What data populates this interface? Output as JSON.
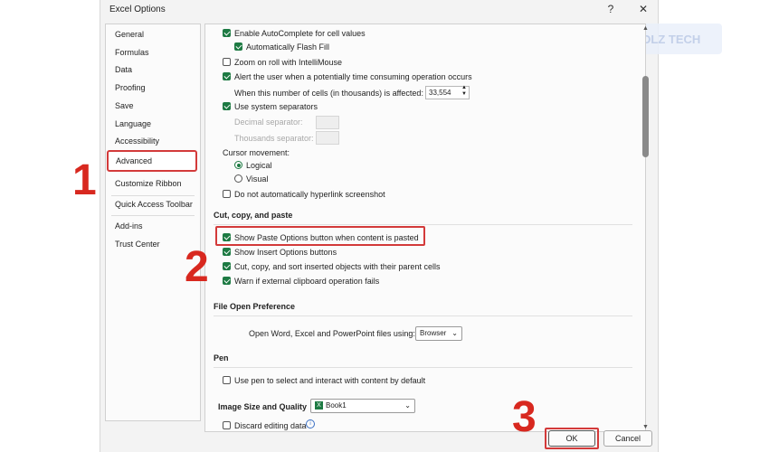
{
  "window": {
    "title": "Excel Options",
    "help": "?",
    "close": "✕"
  },
  "watermark": {
    "text": "DLZ TECH"
  },
  "nav": {
    "items": [
      "General",
      "Formulas",
      "Data",
      "Proofing",
      "Save",
      "Language",
      "Accessibility",
      "Advanced",
      "Customize Ribbon",
      "Quick Access Toolbar",
      "Add-ins",
      "Trust Center"
    ],
    "selected": "Advanced"
  },
  "editing": {
    "autocomplete": "Enable AutoComplete for cell values",
    "flash_fill": "Automatically Flash Fill",
    "zoom_roll": "Zoom on roll with IntelliMouse",
    "alert_label": "Alert the user when a potentially time consuming operation occurs",
    "cells_label": "When this number of cells (in thousands) is affected:",
    "cells_value": "33,554",
    "system_sep": "Use system separators",
    "decimal_label": "Decimal separator:",
    "thousands_label": "Thousands separator:",
    "cursor_label": "Cursor movement:",
    "logical": "Logical",
    "visual": "Visual",
    "hyperlink": "Do not automatically hyperlink screenshot"
  },
  "cut_copy": {
    "heading": "Cut, copy, and paste",
    "show_paste": "Show Paste Options button when content is pasted",
    "show_insert": "Show Insert Options buttons",
    "cut_sort": "Cut, copy, and sort inserted objects with their parent cells",
    "warn_clip": "Warn if external clipboard operation fails"
  },
  "file_open": {
    "heading": "File Open Preference",
    "label": "Open Word, Excel and PowerPoint files using:",
    "value": "Browser"
  },
  "pen": {
    "heading": "Pen",
    "label": "Use pen to select and interact with content by default"
  },
  "image": {
    "heading": "Image Size and Quality",
    "workbook": "Book1",
    "discard": "Discard editing data"
  },
  "buttons": {
    "ok": "OK",
    "cancel": "Cancel"
  },
  "annotations": {
    "one": "1",
    "two": "2",
    "three": "3"
  },
  "colors": {
    "accent": "#1d7a43",
    "highlight": "#d33a3a",
    "number": "#d8281f"
  }
}
